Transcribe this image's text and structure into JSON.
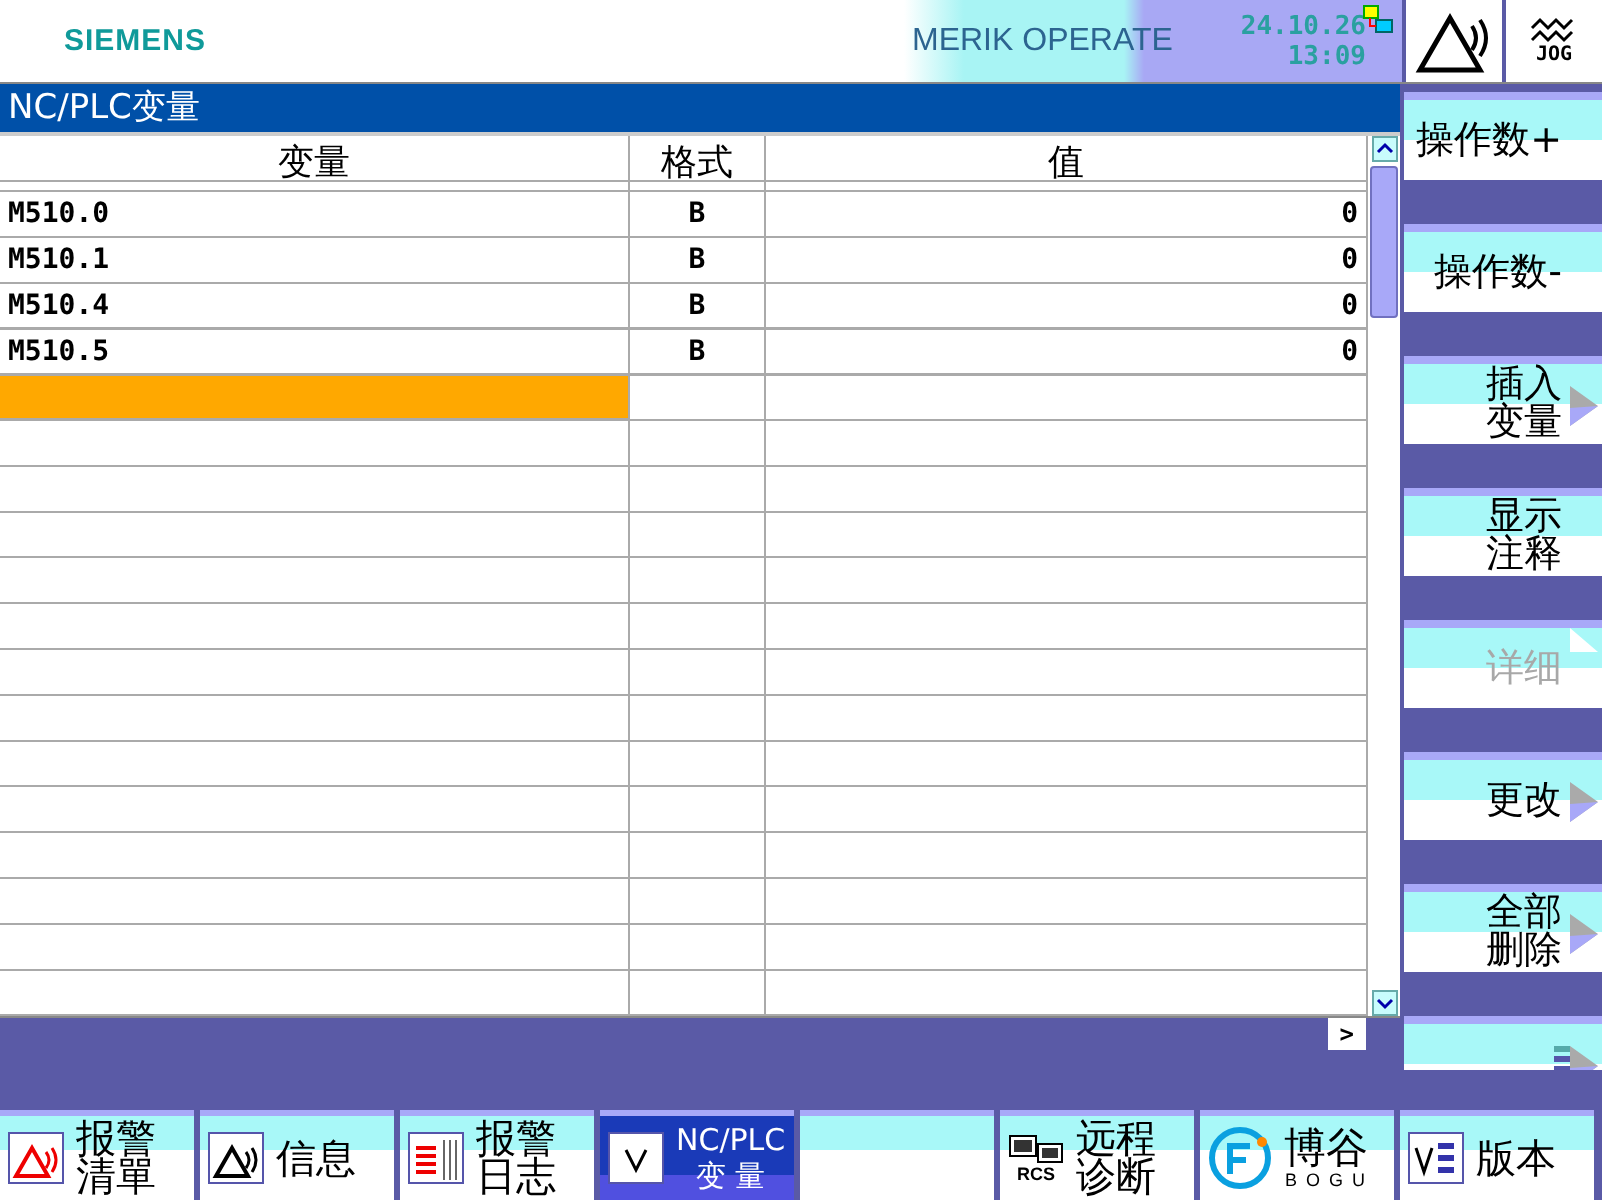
{
  "header": {
    "logo": "SIEMENS",
    "product": "MERIK OPERATE",
    "date": "24.10.26",
    "time": "13:09",
    "mode": "JOG"
  },
  "title": "NC/PLC变量",
  "table": {
    "columns": [
      "变量",
      "格式",
      "值"
    ],
    "rows": [
      {
        "variable": "M510.0",
        "format": "B",
        "value": "0"
      },
      {
        "variable": "M510.1",
        "format": "B",
        "value": "0"
      },
      {
        "variable": "M510.4",
        "format": "B",
        "value": "0"
      },
      {
        "variable": "M510.5",
        "format": "B",
        "value": "0"
      }
    ],
    "input_row": {
      "selected": true
    }
  },
  "scroll_button": ">",
  "vertical_softkeys": [
    {
      "lines": [
        "操作数+"
      ],
      "disabled": false,
      "arrow": false
    },
    {
      "lines": [
        "操作数-"
      ],
      "disabled": false,
      "arrow": false
    },
    {
      "lines": [
        "插入",
        "变量"
      ],
      "disabled": false,
      "arrow": true
    },
    {
      "lines": [
        "显示",
        "注释"
      ],
      "disabled": false,
      "arrow": false
    },
    {
      "lines": [
        "详细"
      ],
      "disabled": true,
      "arrow": true
    },
    {
      "lines": [
        "更改"
      ],
      "disabled": false,
      "arrow": true
    },
    {
      "lines": [
        "全部",
        "删除"
      ],
      "disabled": false,
      "arrow": true
    },
    {
      "kind": "more",
      "disabled": false,
      "arrow": true
    }
  ],
  "horizontal_softkeys": [
    {
      "kind": "alarm-list",
      "lines": [
        "报警",
        "清單"
      ],
      "selected": false
    },
    {
      "kind": "messages",
      "lines": [
        "信息"
      ],
      "selected": false
    },
    {
      "kind": "alarm-log",
      "lines": [
        "报警",
        "日志"
      ],
      "selected": false
    },
    {
      "kind": "variables",
      "lines": [
        "NC/PLC",
        "变 量"
      ],
      "selected": true
    },
    {
      "kind": "empty",
      "selected": false
    },
    {
      "kind": "remote",
      "lines": [
        "远程",
        "诊断"
      ],
      "icon_text": "RCS",
      "selected": false
    },
    {
      "kind": "logo",
      "lines": [
        "博谷"
      ],
      "icon_text": "B O G U",
      "selected": false
    },
    {
      "kind": "version",
      "lines": [
        "版本"
      ],
      "selected": false
    }
  ]
}
